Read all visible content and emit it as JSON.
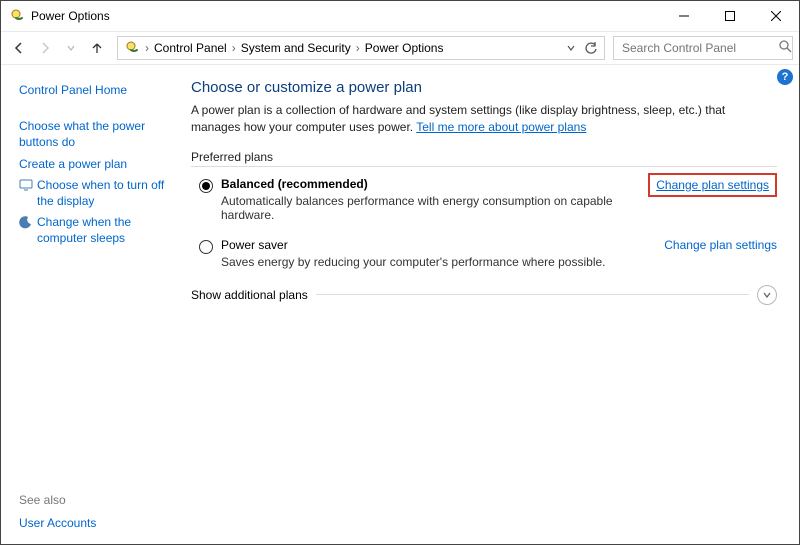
{
  "titlebar": {
    "title": "Power Options"
  },
  "breadcrumb": {
    "items": [
      "Control Panel",
      "System and Security",
      "Power Options"
    ]
  },
  "search": {
    "placeholder": "Search Control Panel"
  },
  "sidebar": {
    "home": "Control Panel Home",
    "links": [
      "Choose what the power buttons do",
      "Create a power plan",
      "Choose when to turn off the display",
      "Change when the computer sleeps"
    ],
    "see_also_label": "See also",
    "see_also_links": [
      "User Accounts"
    ]
  },
  "main": {
    "title": "Choose or customize a power plan",
    "description": "A power plan is a collection of hardware and system settings (like display brightness, sleep, etc.) that manages how your computer uses power. ",
    "tell_more": "Tell me more about power plans",
    "preferred_label": "Preferred plans",
    "plans": [
      {
        "name": "Balanced (recommended)",
        "desc": "Automatically balances performance with energy consumption on capable hardware.",
        "change": "Change plan settings",
        "selected": true,
        "highlight": true
      },
      {
        "name": "Power saver",
        "desc": "Saves energy by reducing your computer's performance where possible.",
        "change": "Change plan settings",
        "selected": false,
        "highlight": false
      }
    ],
    "show_additional": "Show additional plans"
  }
}
